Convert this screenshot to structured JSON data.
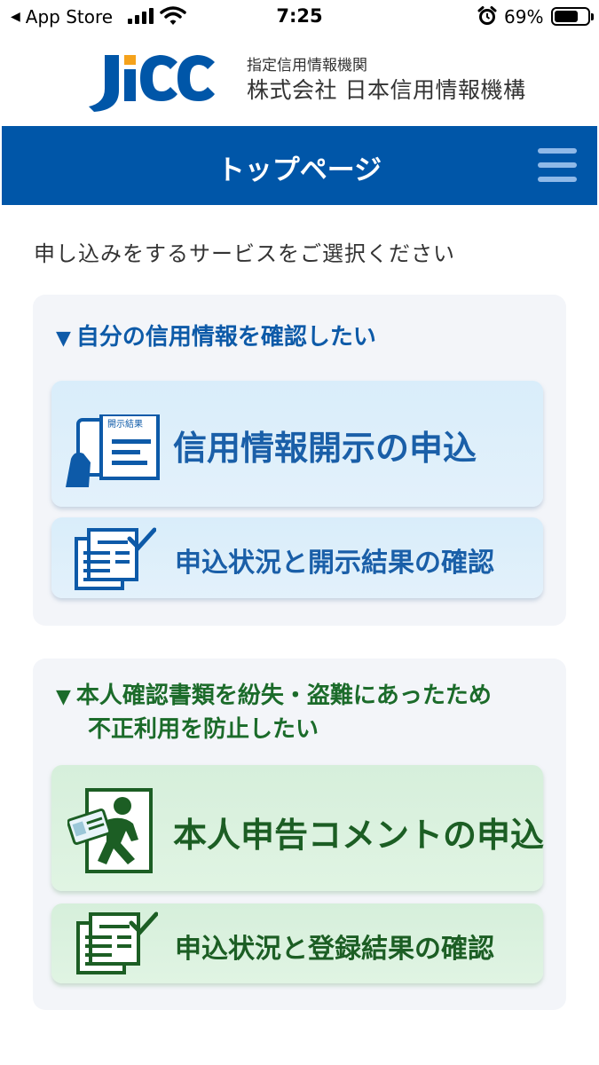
{
  "status_bar": {
    "back_app": "App Store",
    "time": "7:25",
    "battery": "69%"
  },
  "header": {
    "logo_text": "JICC",
    "org_subtitle": "指定信用情報機関",
    "org_name": "株式会社 日本信用情報機構"
  },
  "nav": {
    "title": "トップページ"
  },
  "prompt": "申し込みをするサービスをご選択ください",
  "sections": [
    {
      "heading": "自分の信用情報を確認したい",
      "buttons": [
        {
          "label": "信用情報開示の申込",
          "icon": "document-phone-icon",
          "icon_badge": "開示結果"
        },
        {
          "label": "申込状況と開示結果の確認",
          "icon": "documents-check-icon"
        }
      ]
    },
    {
      "heading_line1": "本人確認書類を紛失・盗難にあったため",
      "heading_line2": "不正利用を防止したい",
      "buttons": [
        {
          "label": "本人申告コメントの申込",
          "icon": "stolen-id-card-icon"
        },
        {
          "label": "申込状況と登録結果の確認",
          "icon": "documents-check-icon"
        }
      ]
    }
  ],
  "colors": {
    "brand_blue": "#0056a8",
    "heading_blue": "#0d5aa8",
    "heading_green": "#1b6b2a",
    "logo_orange": "#f5a21b"
  }
}
